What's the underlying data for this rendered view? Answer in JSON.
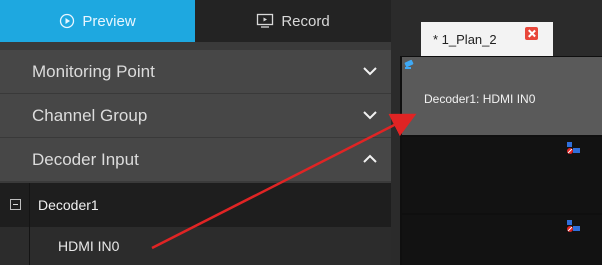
{
  "tabs": {
    "preview_label": "Preview",
    "record_label": "Record",
    "active": "preview"
  },
  "accordion": [
    {
      "label": "Monitoring Point",
      "state": "collapsed"
    },
    {
      "label": "Channel Group",
      "state": "collapsed"
    },
    {
      "label": "Decoder Input",
      "state": "expanded"
    }
  ],
  "tree": {
    "decoder_label": "Decoder1",
    "input_label": "HDMI IN0"
  },
  "plan_tab": {
    "label": "* 1_Plan_2"
  },
  "grid": {
    "cell1_label": "Decoder1: HDMI IN0"
  },
  "colors": {
    "accent": "#1ea8e0",
    "arrow": "#e02424",
    "close": "#e8473a"
  },
  "icons": {
    "preview": "play-circle-icon",
    "record": "monitor-icon",
    "expand": "chevron-down-icon",
    "collapse": "chevron-up-icon",
    "tree_toggle": "minus-box-icon",
    "camera": "camera-icon",
    "decoder": "decoder-icon"
  }
}
